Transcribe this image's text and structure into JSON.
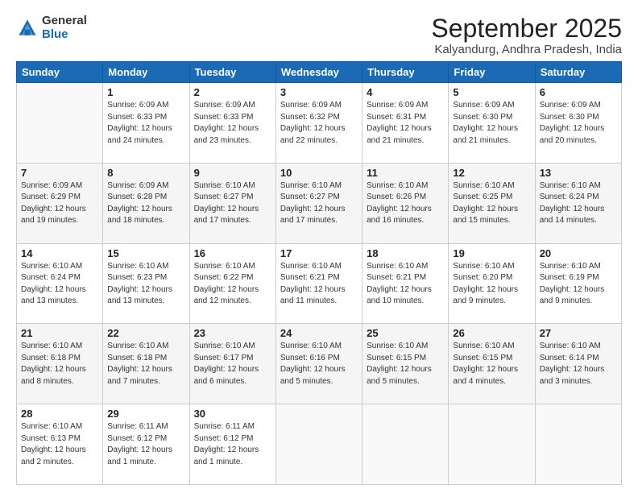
{
  "logo": {
    "general": "General",
    "blue": "Blue"
  },
  "header": {
    "month": "September 2025",
    "location": "Kalyandurg, Andhra Pradesh, India"
  },
  "days_of_week": [
    "Sunday",
    "Monday",
    "Tuesday",
    "Wednesday",
    "Thursday",
    "Friday",
    "Saturday"
  ],
  "weeks": [
    [
      {
        "day": "",
        "info": ""
      },
      {
        "day": "1",
        "info": "Sunrise: 6:09 AM\nSunset: 6:33 PM\nDaylight: 12 hours\nand 24 minutes."
      },
      {
        "day": "2",
        "info": "Sunrise: 6:09 AM\nSunset: 6:33 PM\nDaylight: 12 hours\nand 23 minutes."
      },
      {
        "day": "3",
        "info": "Sunrise: 6:09 AM\nSunset: 6:32 PM\nDaylight: 12 hours\nand 22 minutes."
      },
      {
        "day": "4",
        "info": "Sunrise: 6:09 AM\nSunset: 6:31 PM\nDaylight: 12 hours\nand 21 minutes."
      },
      {
        "day": "5",
        "info": "Sunrise: 6:09 AM\nSunset: 6:30 PM\nDaylight: 12 hours\nand 21 minutes."
      },
      {
        "day": "6",
        "info": "Sunrise: 6:09 AM\nSunset: 6:30 PM\nDaylight: 12 hours\nand 20 minutes."
      }
    ],
    [
      {
        "day": "7",
        "info": "Sunrise: 6:09 AM\nSunset: 6:29 PM\nDaylight: 12 hours\nand 19 minutes."
      },
      {
        "day": "8",
        "info": "Sunrise: 6:09 AM\nSunset: 6:28 PM\nDaylight: 12 hours\nand 18 minutes."
      },
      {
        "day": "9",
        "info": "Sunrise: 6:10 AM\nSunset: 6:27 PM\nDaylight: 12 hours\nand 17 minutes."
      },
      {
        "day": "10",
        "info": "Sunrise: 6:10 AM\nSunset: 6:27 PM\nDaylight: 12 hours\nand 17 minutes."
      },
      {
        "day": "11",
        "info": "Sunrise: 6:10 AM\nSunset: 6:26 PM\nDaylight: 12 hours\nand 16 minutes."
      },
      {
        "day": "12",
        "info": "Sunrise: 6:10 AM\nSunset: 6:25 PM\nDaylight: 12 hours\nand 15 minutes."
      },
      {
        "day": "13",
        "info": "Sunrise: 6:10 AM\nSunset: 6:24 PM\nDaylight: 12 hours\nand 14 minutes."
      }
    ],
    [
      {
        "day": "14",
        "info": "Sunrise: 6:10 AM\nSunset: 6:24 PM\nDaylight: 12 hours\nand 13 minutes."
      },
      {
        "day": "15",
        "info": "Sunrise: 6:10 AM\nSunset: 6:23 PM\nDaylight: 12 hours\nand 13 minutes."
      },
      {
        "day": "16",
        "info": "Sunrise: 6:10 AM\nSunset: 6:22 PM\nDaylight: 12 hours\nand 12 minutes."
      },
      {
        "day": "17",
        "info": "Sunrise: 6:10 AM\nSunset: 6:21 PM\nDaylight: 12 hours\nand 11 minutes."
      },
      {
        "day": "18",
        "info": "Sunrise: 6:10 AM\nSunset: 6:21 PM\nDaylight: 12 hours\nand 10 minutes."
      },
      {
        "day": "19",
        "info": "Sunrise: 6:10 AM\nSunset: 6:20 PM\nDaylight: 12 hours\nand 9 minutes."
      },
      {
        "day": "20",
        "info": "Sunrise: 6:10 AM\nSunset: 6:19 PM\nDaylight: 12 hours\nand 9 minutes."
      }
    ],
    [
      {
        "day": "21",
        "info": "Sunrise: 6:10 AM\nSunset: 6:18 PM\nDaylight: 12 hours\nand 8 minutes."
      },
      {
        "day": "22",
        "info": "Sunrise: 6:10 AM\nSunset: 6:18 PM\nDaylight: 12 hours\nand 7 minutes."
      },
      {
        "day": "23",
        "info": "Sunrise: 6:10 AM\nSunset: 6:17 PM\nDaylight: 12 hours\nand 6 minutes."
      },
      {
        "day": "24",
        "info": "Sunrise: 6:10 AM\nSunset: 6:16 PM\nDaylight: 12 hours\nand 5 minutes."
      },
      {
        "day": "25",
        "info": "Sunrise: 6:10 AM\nSunset: 6:15 PM\nDaylight: 12 hours\nand 5 minutes."
      },
      {
        "day": "26",
        "info": "Sunrise: 6:10 AM\nSunset: 6:15 PM\nDaylight: 12 hours\nand 4 minutes."
      },
      {
        "day": "27",
        "info": "Sunrise: 6:10 AM\nSunset: 6:14 PM\nDaylight: 12 hours\nand 3 minutes."
      }
    ],
    [
      {
        "day": "28",
        "info": "Sunrise: 6:10 AM\nSunset: 6:13 PM\nDaylight: 12 hours\nand 2 minutes."
      },
      {
        "day": "29",
        "info": "Sunrise: 6:11 AM\nSunset: 6:12 PM\nDaylight: 12 hours\nand 1 minute."
      },
      {
        "day": "30",
        "info": "Sunrise: 6:11 AM\nSunset: 6:12 PM\nDaylight: 12 hours\nand 1 minute."
      },
      {
        "day": "",
        "info": ""
      },
      {
        "day": "",
        "info": ""
      },
      {
        "day": "",
        "info": ""
      },
      {
        "day": "",
        "info": ""
      }
    ]
  ]
}
